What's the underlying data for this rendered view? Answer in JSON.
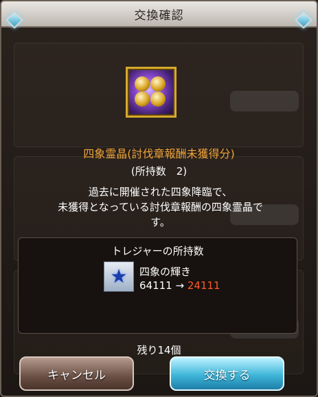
{
  "dialog": {
    "title": "交換確認"
  },
  "item": {
    "name": "四象霊晶(討伐章報酬未獲得分)",
    "owned_label": "(所持数　2)",
    "description": [
      "過去に開催された四象降臨で、",
      "未獲得となっている討伐章報酬の四象霊晶で",
      "す。"
    ]
  },
  "treasure": {
    "section_title": "トレジャーの所持数",
    "name": "四象の輝き",
    "before": "64111",
    "arrow": "→",
    "after": "24111"
  },
  "remaining": "残り14個",
  "buttons": {
    "cancel": "キャンセル",
    "exchange": "交換する"
  },
  "icons": {
    "header_left": "blue-diamond-gem-icon",
    "header_right": "blue-diamond-gem-icon",
    "item": "four-symbols-orb-icon",
    "treasure": "blue-star-icon"
  },
  "colors": {
    "item_name": "#f0a43a",
    "count_after": "#ff5a28",
    "cancel_button": "#6a4f44",
    "exchange_button": "#3fb6d9"
  }
}
